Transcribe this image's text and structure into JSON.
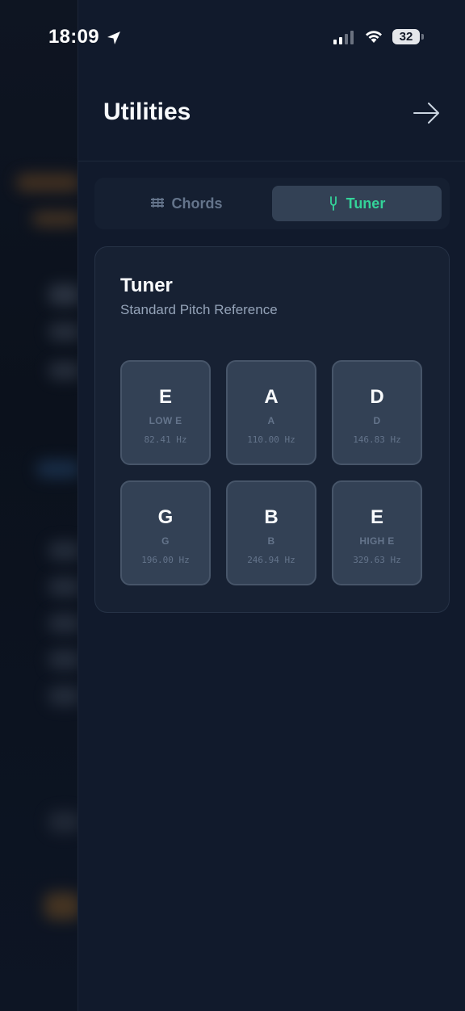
{
  "status_bar": {
    "time": "18:09",
    "battery": "32",
    "icons": [
      "location-arrow-icon",
      "signal-icon",
      "wifi-icon",
      "battery-icon"
    ]
  },
  "panel": {
    "title": "Utilities",
    "close_icon": "arrow-right-icon"
  },
  "tabs": [
    {
      "label": "Chords",
      "icon": "chord-chart-icon",
      "active": false
    },
    {
      "label": "Tuner",
      "icon": "tuning-fork-icon",
      "active": true
    }
  ],
  "tuner": {
    "title": "Tuner",
    "subtitle": "Standard Pitch Reference",
    "strings": [
      {
        "note": "E",
        "name": "LOW E",
        "freq": "82.41 Hz"
      },
      {
        "note": "A",
        "name": "A",
        "freq": "110.00 Hz"
      },
      {
        "note": "D",
        "name": "D",
        "freq": "146.83 Hz"
      },
      {
        "note": "G",
        "name": "G",
        "freq": "196.00 Hz"
      },
      {
        "note": "B",
        "name": "B",
        "freq": "246.94 Hz"
      },
      {
        "note": "E",
        "name": "HIGH E",
        "freq": "329.63 Hz"
      }
    ]
  },
  "colors": {
    "accent": "#34d399",
    "panel_bg": "#111a2c",
    "card_bg": "#172133",
    "button_bg": "#334155"
  }
}
